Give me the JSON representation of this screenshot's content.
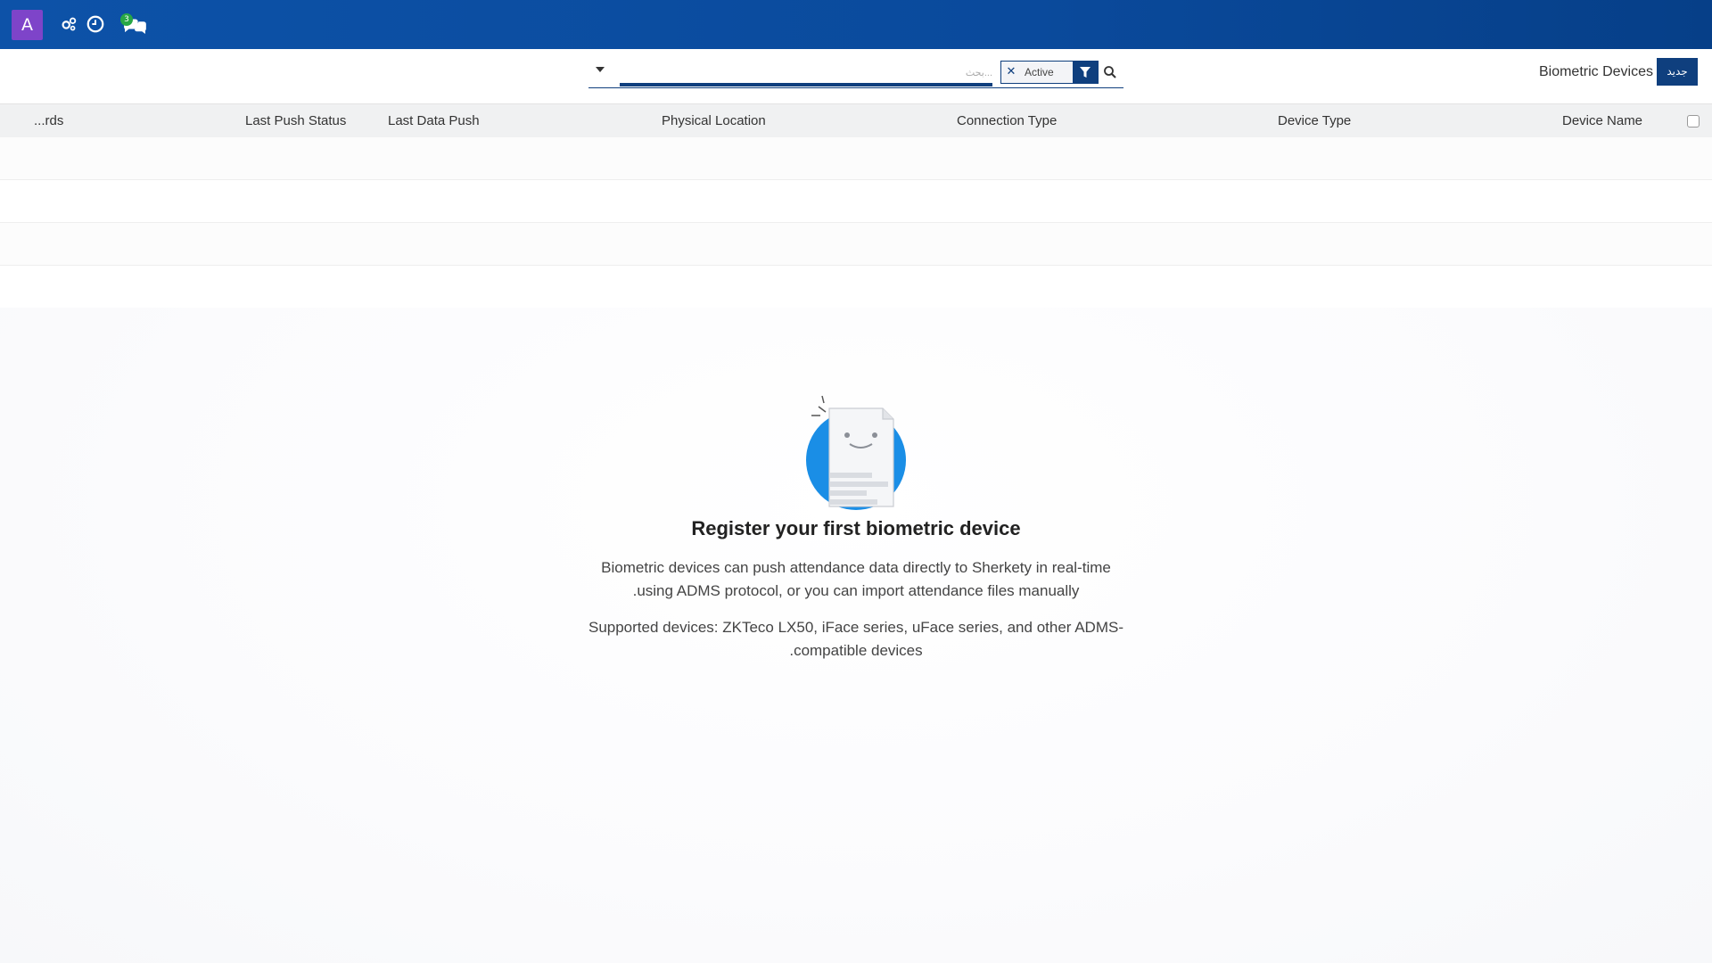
{
  "topbar": {
    "avatar_letter": "A",
    "messages_count": "3",
    "icons": [
      "settings-cog-icon",
      "clock-icon",
      "chat-icon"
    ],
    "colors": {
      "bar": "#0a4a9c",
      "avatar": "#7e44c9",
      "badge": "#28a745"
    }
  },
  "control": {
    "new_label": "جديد",
    "title": "Biometric Devices",
    "search_placeholder": "بحث...",
    "facet_value": "Active"
  },
  "table": {
    "columns": {
      "device_name": "Device Name",
      "device_type": "Device Type",
      "connection_type": "Connection Type",
      "physical_location": "Physical Location",
      "last_data_push": "Last Data Push",
      "last_push_status": "Last Push Status",
      "records": "...rds"
    }
  },
  "empty": {
    "title": "Register your first biometric device",
    "line1": "Biometric devices can push attendance data directly to Sherkety in real-time",
    "line2": ".using ADMS protocol, or you can import attendance files manually",
    "line3": "Supported devices: ZKTeco LX50, iFace series, uFace series, and other ADMS-",
    "line4": ".compatible devices"
  }
}
